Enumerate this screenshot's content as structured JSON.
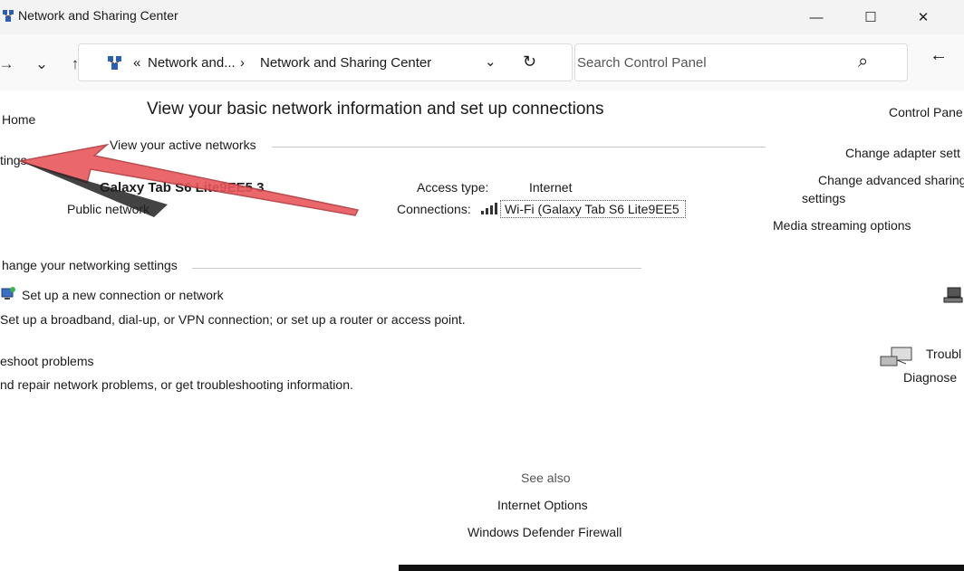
{
  "window": {
    "title": "Network and Sharing Center",
    "minimize_glyph": "—",
    "maximize_glyph": "☐",
    "close_glyph": "✕"
  },
  "toolbar": {
    "back_glyph": "→",
    "history_glyph": "⌄",
    "up_glyph": "↑",
    "breadcrumb": {
      "chevron_left": "«",
      "parent": "Network and...",
      "separator": "›",
      "current": "Network and Sharing Center"
    },
    "dropdown_glyph": "⌄",
    "refresh_glyph": "↻",
    "search_placeholder": "Search Control Panel",
    "search_glyph": "⌕",
    "right_arrow_glyph": "←"
  },
  "left_nav": {
    "home": "Home",
    "settings_fragment": "tings"
  },
  "main": {
    "heading": "View your basic network information and set up connections",
    "active_networks_label": "View your active networks",
    "network_name": "Galaxy Tab S6 Lite9EE5 3",
    "network_type": "Public network",
    "access_type_label": "Access type:",
    "access_type_value": "Internet",
    "connections_label": "Connections:",
    "connections_value": "Wi-Fi (Galaxy Tab S6 Lite9EE5",
    "change_settings_label": "hange your networking settings",
    "setup_connection_title": "Set up a new connection or network",
    "setup_connection_desc": "Set up a broadband, dial-up, or VPN connection; or set up a router or access point.",
    "troubleshoot_title": "eshoot problems",
    "troubleshoot_desc": "nd repair network problems, or get troubleshooting information."
  },
  "right_side": {
    "control_panel": "Control Pane",
    "change_adapter": "Change adapter sett",
    "change_advanced_line1": "Change advanced sharing",
    "change_advanced_line2": "settings",
    "media_streaming": "Media streaming options",
    "troubleshoot_short": "Troubl",
    "diagnose": "Diagnose"
  },
  "see_also": {
    "heading": "See also",
    "internet_options": "Internet Options",
    "firewall": "Windows Defender Firewall"
  },
  "colors": {
    "arrow": "#e8575b",
    "arrow_outline": "#b23a3d",
    "titlebar": "#f3f3f3",
    "separator": "#c8c8c8"
  }
}
